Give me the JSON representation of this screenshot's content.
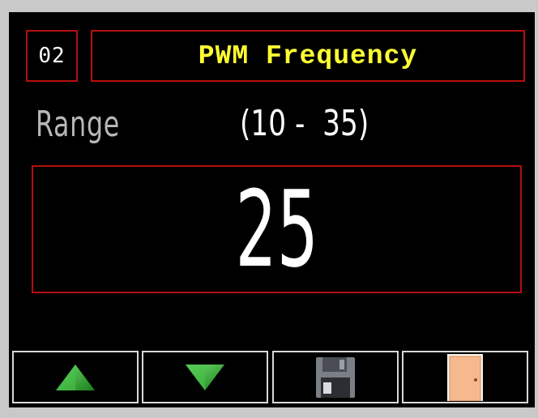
{
  "header": {
    "parameter_number": "02",
    "title": "PWM Frequency"
  },
  "range": {
    "label": "Range",
    "values": "(10 -  35)",
    "min": 10,
    "max": 35
  },
  "current_value": "25",
  "buttons": [
    {
      "name": "increase",
      "icon": "up-arrow-icon"
    },
    {
      "name": "decrease",
      "icon": "down-arrow-icon"
    },
    {
      "name": "save",
      "icon": "floppy-disk-icon"
    },
    {
      "name": "exit",
      "icon": "door-icon"
    }
  ],
  "colors": {
    "background": "#000000",
    "border": "#b30f0f",
    "title": "#ffff33",
    "value": "#ffffff",
    "label": "#b7b7b7",
    "arrow": "#2fa82f"
  }
}
